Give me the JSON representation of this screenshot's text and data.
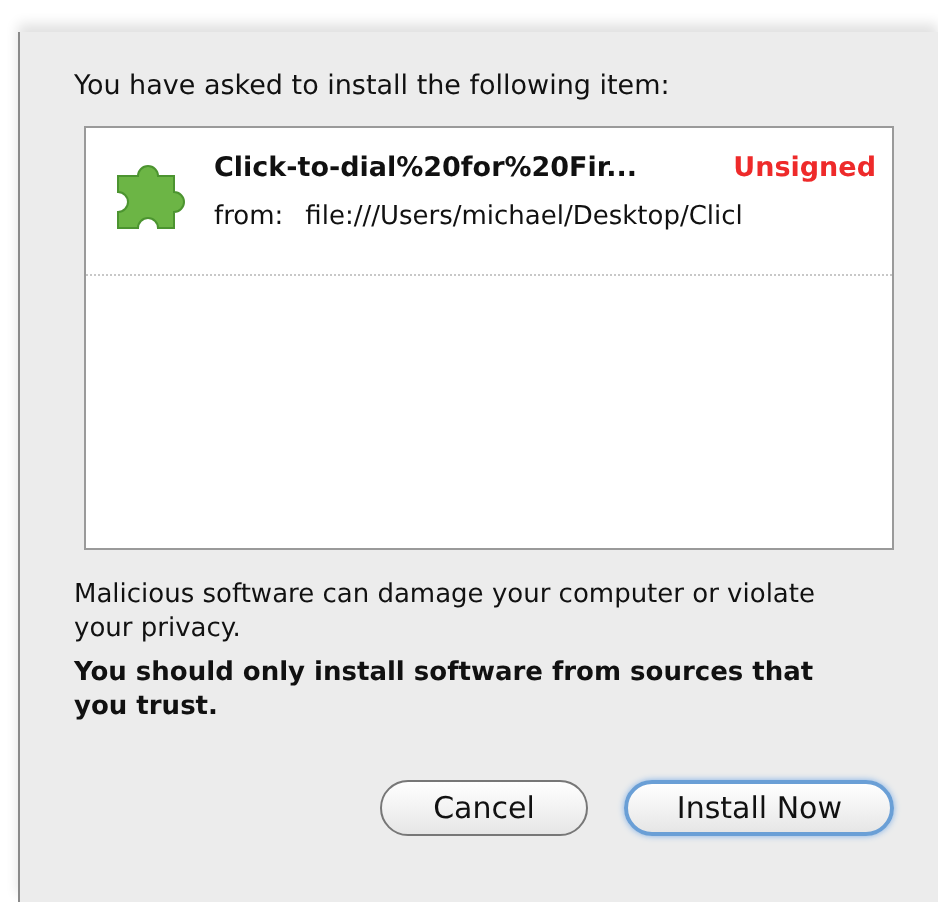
{
  "intro": "You have asked to install the following item:",
  "items": [
    {
      "name": "Click-to-dial%20for%20Fir...",
      "status": "Unsigned",
      "from_label": "from:",
      "from": "file:///Users/michael/Desktop/Clicl"
    }
  ],
  "warning": "Malicious software can damage your computer or violate your privacy.",
  "advice": "You should only install software from sources that you trust.",
  "buttons": [
    {
      "label": "Cancel",
      "default": false
    },
    {
      "label": "Install Now",
      "default": true
    }
  ]
}
